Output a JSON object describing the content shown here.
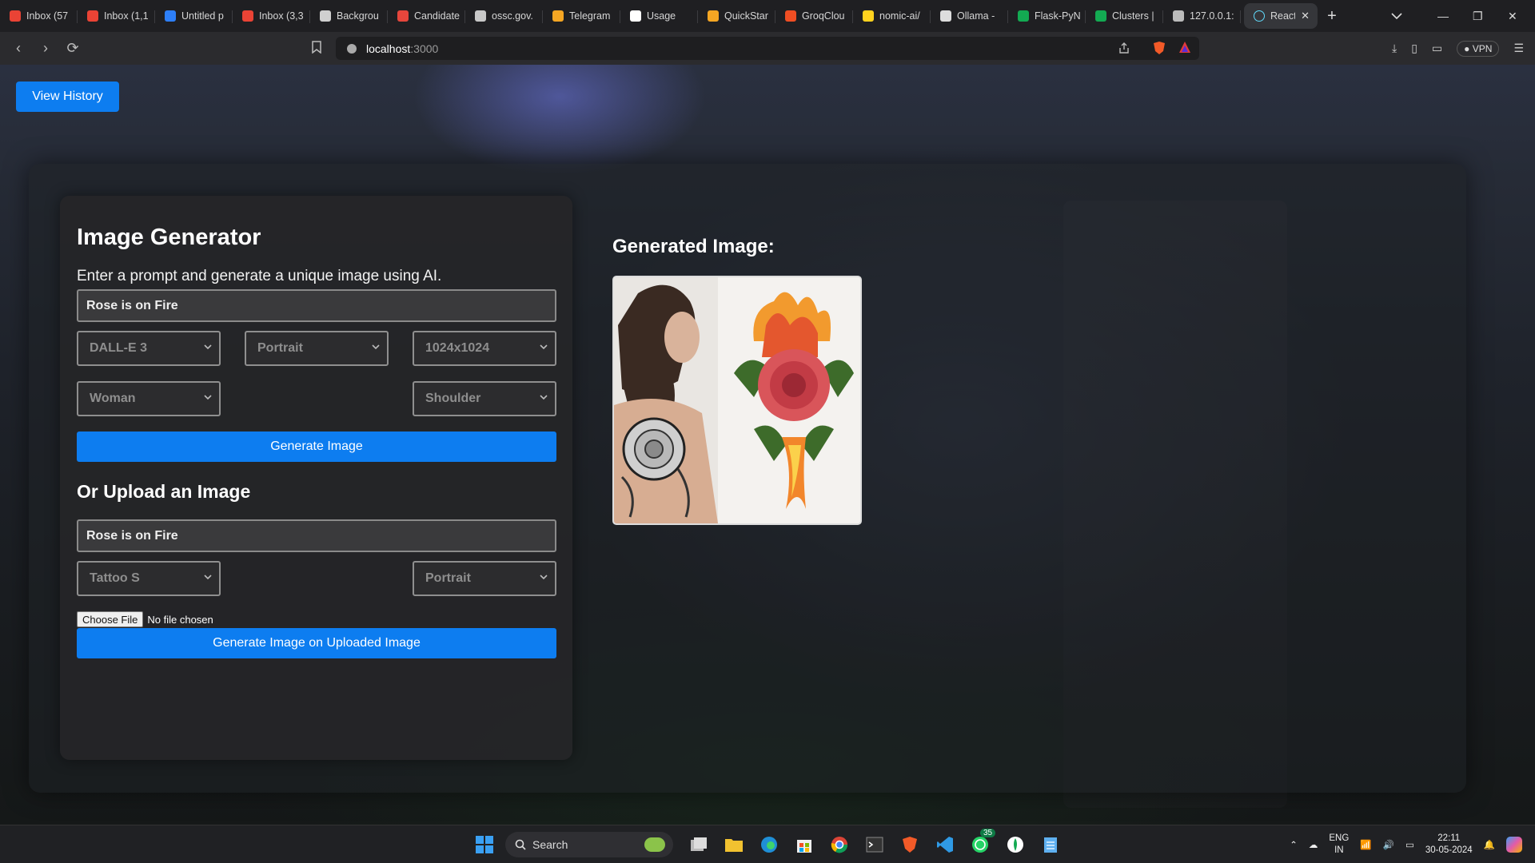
{
  "browser": {
    "tabs": [
      {
        "title": "Inbox (57",
        "color": "#ea4335"
      },
      {
        "title": "Inbox (1,1",
        "color": "#ea4335"
      },
      {
        "title": "Untitled p",
        "color": "#2d7ff9"
      },
      {
        "title": "Inbox (3,3",
        "color": "#ea4335"
      },
      {
        "title": "Backgrou",
        "color": "#d0d0d0"
      },
      {
        "title": "Candidate",
        "color": "#e6463c"
      },
      {
        "title": "ossc.gov.",
        "color": "#c8c8c8"
      },
      {
        "title": "Telegram",
        "color": "#f5a623"
      },
      {
        "title": "Usage",
        "color": "#ffffff"
      },
      {
        "title": "QuickStar",
        "color": "#f5a623"
      },
      {
        "title": "GroqClou",
        "color": "#f04e23"
      },
      {
        "title": "nomic-ai/",
        "color": "#ffd21e"
      },
      {
        "title": "Ollama - ",
        "color": "#dddddd"
      },
      {
        "title": "Flask-PyN",
        "color": "#13aa52"
      },
      {
        "title": "Clusters |",
        "color": "#13aa52"
      },
      {
        "title": "127.0.0.1:",
        "color": "#bbbbbb"
      }
    ],
    "active_tab": {
      "title": "React",
      "color": "#61dafb"
    },
    "address": {
      "host": "localhost",
      "port": ":3000"
    },
    "vpn_label": "VPN"
  },
  "page": {
    "history_button": "View History",
    "form": {
      "title": "Image Generator",
      "subtitle": "Enter a prompt and generate a unique image using AI.",
      "prompt_value": "Rose is on Fire",
      "model_select": "DALL-E 3",
      "orientation_select": "Portrait",
      "size_select": "1024x1024",
      "subject_select": "Woman",
      "placement_select": "Shoulder",
      "generate_button": "Generate Image"
    },
    "upload": {
      "title": "Or Upload an Image",
      "prompt_value": "Rose is on Fire",
      "style_select": "Tattoo S",
      "orientation_select": "Portrait",
      "choose_file_button": "Choose File",
      "file_status": "No file chosen",
      "generate_button": "Generate Image on Uploaded Image"
    },
    "result": {
      "title": "Generated Image:"
    }
  },
  "taskbar": {
    "search_label": "Search",
    "whatsapp_badge": "35",
    "lang_top": "ENG",
    "lang_bottom": "IN",
    "time": "22:11",
    "date": "30-05-2024"
  }
}
